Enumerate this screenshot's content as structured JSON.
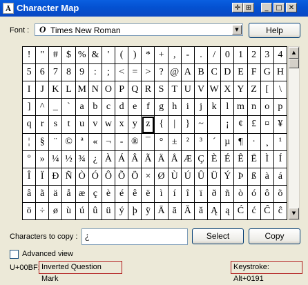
{
  "window": {
    "title": "Character Map"
  },
  "font": {
    "label": "Font :",
    "value": "Times New Roman",
    "icon": "truetype-icon"
  },
  "buttons": {
    "help": "Help",
    "select": "Select",
    "copy": "Copy"
  },
  "copy": {
    "label": "Characters to copy :",
    "value": "¿"
  },
  "advanced": {
    "label": "Advanced view",
    "checked": false
  },
  "status": {
    "code": "U+00BF:",
    "name": "Inverted Question Mark",
    "keystroke": "Keystroke: Alt+0191"
  },
  "grid": {
    "selected_index": 89,
    "chars": [
      "!",
      "\"",
      "#",
      "$",
      "%",
      "&",
      "'",
      "(",
      ")",
      "*",
      "+",
      ",",
      "-",
      ".",
      "/",
      "0",
      "1",
      "2",
      "3",
      "4",
      "5",
      "6",
      "7",
      "8",
      "9",
      ":",
      ";",
      "<",
      "=",
      ">",
      "?",
      "@",
      "A",
      "B",
      "C",
      "D",
      "E",
      "F",
      "G",
      "H",
      "I",
      "J",
      "K",
      "L",
      "M",
      "N",
      "O",
      "P",
      "Q",
      "R",
      "S",
      "T",
      "U",
      "V",
      "W",
      "X",
      "Y",
      "Z",
      "[",
      "\\",
      "]",
      "^",
      "_",
      "`",
      "a",
      "b",
      "c",
      "d",
      "e",
      "f",
      "g",
      "h",
      "i",
      "j",
      "k",
      "l",
      "m",
      "n",
      "o",
      "p",
      "q",
      "r",
      "s",
      "t",
      "u",
      "v",
      "w",
      "x",
      "y",
      "z",
      "{",
      "|",
      "}",
      "~",
      " ",
      "¡",
      "¢",
      "£",
      "¤",
      "¥",
      "¦",
      "§",
      "¨",
      "©",
      "ª",
      "«",
      "¬",
      "-",
      "®",
      "¯",
      "°",
      "±",
      "²",
      "³",
      "´",
      "µ",
      "¶",
      "·",
      "¸",
      "¹",
      "º",
      "»",
      "¼",
      "½",
      "¾",
      "¿",
      "À",
      "Á",
      "Â",
      "Ã",
      "Ä",
      "Å",
      "Æ",
      "Ç",
      "È",
      "É",
      "Ê",
      "Ë",
      "Ì",
      "Í",
      "Î",
      "Ï",
      "Ð",
      "Ñ",
      "Ò",
      "Ó",
      "Ô",
      "Õ",
      "Ö",
      "×",
      "Ø",
      "Ù",
      "Ú",
      "Û",
      "Ü",
      "Ý",
      "Þ",
      "ß",
      "à",
      "á",
      "â",
      "ã",
      "ä",
      "å",
      "æ",
      "ç",
      "è",
      "é",
      "ê",
      "ë",
      "ì",
      "í",
      "î",
      "ï",
      "ð",
      "ñ",
      "ò",
      "ó",
      "ô",
      "õ",
      "ö",
      "÷",
      "ø",
      "ù",
      "ú",
      "û",
      "ü",
      "ý",
      "þ",
      "ÿ",
      "Ā",
      "ā",
      "Ă",
      "ă",
      "Ą",
      "ą",
      "Ć",
      "ć",
      "Ĉ",
      "ĉ"
    ]
  }
}
